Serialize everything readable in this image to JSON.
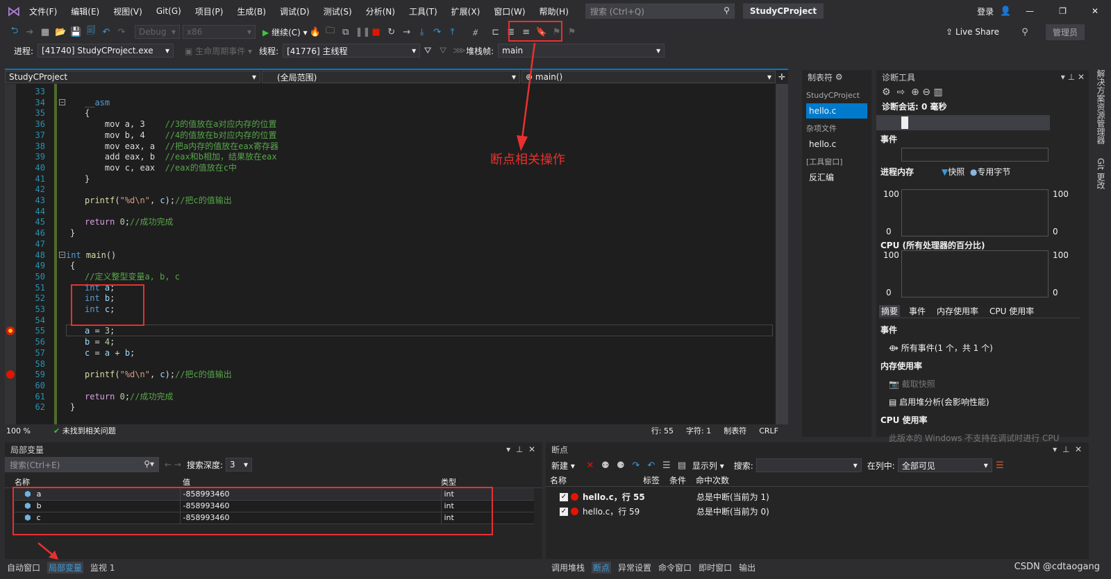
{
  "menu": {
    "items": [
      "文件(F)",
      "编辑(E)",
      "视图(V)",
      "Git(G)",
      "项目(P)",
      "生成(B)",
      "调试(D)",
      "测试(S)",
      "分析(N)",
      "工具(T)",
      "扩展(X)",
      "窗口(W)",
      "帮助(H)"
    ],
    "search_placeholder": "搜索 (Ctrl+Q)",
    "project": "StudyCProject",
    "signin": "登录"
  },
  "toolbar": {
    "config": "Debug",
    "platform": "x86",
    "continue": "继续(C)",
    "live_share": "Live Share",
    "admin": "管理员"
  },
  "debugbar": {
    "process_label": "进程:",
    "process": "[41740] StudyCProject.exe",
    "lifecycle": "生命周期事件",
    "thread_label": "线程:",
    "thread": "[41776] 主线程",
    "stack_label": "堆栈帧:",
    "stack": "main"
  },
  "editor": {
    "project_combo": "StudyCProject",
    "scope_combo": "(全局范围)",
    "func_combo": "main()",
    "zoom": "100 %",
    "issues": "未找到相关问题",
    "row": "行: 55",
    "col": "字符: 1",
    "tabs": "制表符",
    "eol": "CRLF",
    "lines": [
      {
        "n": "33",
        "t": []
      },
      {
        "n": "34",
        "t": [
          {
            "c": "kw",
            "s": "__asm"
          }
        ]
      },
      {
        "n": "35",
        "t": [
          {
            "c": "pl",
            "s": "{"
          }
        ]
      },
      {
        "n": "36",
        "t": [
          {
            "c": "pl",
            "s": "    mov a, 3    "
          },
          {
            "c": "cm",
            "s": "//3的值放在a对应内存的位置"
          }
        ]
      },
      {
        "n": "37",
        "t": [
          {
            "c": "pl",
            "s": "    mov b, 4    "
          },
          {
            "c": "cm",
            "s": "//4的值放在b对应内存的位置"
          }
        ]
      },
      {
        "n": "38",
        "t": [
          {
            "c": "pl",
            "s": "    mov eax, a  "
          },
          {
            "c": "cm",
            "s": "//把a内存的值放在eax寄存器"
          }
        ]
      },
      {
        "n": "39",
        "t": [
          {
            "c": "pl",
            "s": "    add eax, b  "
          },
          {
            "c": "cm",
            "s": "//eax和b相加，结果放在eax"
          }
        ]
      },
      {
        "n": "40",
        "t": [
          {
            "c": "pl",
            "s": "    mov c, eax  "
          },
          {
            "c": "cm",
            "s": "//eax的值放在c中"
          }
        ]
      },
      {
        "n": "41",
        "t": [
          {
            "c": "pl",
            "s": "}"
          }
        ]
      },
      {
        "n": "42",
        "t": []
      },
      {
        "n": "43",
        "t": [
          {
            "c": "fn",
            "s": "printf"
          },
          {
            "c": "pl",
            "s": "("
          },
          {
            "c": "st",
            "s": "\"%d\\n\""
          },
          {
            "c": "pl",
            "s": ", "
          },
          {
            "c": "var",
            "s": "c"
          },
          {
            "c": "pl",
            "s": ");"
          },
          {
            "c": "cm",
            "s": "//把c的值输出"
          }
        ]
      },
      {
        "n": "44",
        "t": []
      },
      {
        "n": "45",
        "t": [
          {
            "c": "ct",
            "s": "return "
          },
          {
            "c": "num",
            "s": "0"
          },
          {
            "c": "pl",
            "s": ";"
          },
          {
            "c": "cm",
            "s": "//成功完成"
          }
        ]
      },
      {
        "n": "46",
        "t": [
          {
            "c": "pl",
            "s": "}"
          }
        ],
        "indent": -1
      },
      {
        "n": "47",
        "t": []
      },
      {
        "n": "48",
        "t": [
          {
            "c": "kw",
            "s": "int "
          },
          {
            "c": "fn",
            "s": "main"
          },
          {
            "c": "pl",
            "s": "()"
          }
        ],
        "indent": -2
      },
      {
        "n": "49",
        "t": [
          {
            "c": "pl",
            "s": "{"
          }
        ],
        "indent": -1
      },
      {
        "n": "50",
        "t": [
          {
            "c": "cm",
            "s": "//定义整型变量a, b, c"
          }
        ]
      },
      {
        "n": "51",
        "t": [
          {
            "c": "kw",
            "s": "int "
          },
          {
            "c": "var",
            "s": "a"
          },
          {
            "c": "pl",
            "s": ";"
          }
        ]
      },
      {
        "n": "52",
        "t": [
          {
            "c": "kw",
            "s": "int "
          },
          {
            "c": "var",
            "s": "b"
          },
          {
            "c": "pl",
            "s": ";"
          }
        ]
      },
      {
        "n": "53",
        "t": [
          {
            "c": "kw",
            "s": "int "
          },
          {
            "c": "var",
            "s": "c"
          },
          {
            "c": "pl",
            "s": ";"
          }
        ]
      },
      {
        "n": "54",
        "t": []
      },
      {
        "n": "55",
        "t": [
          {
            "c": "var",
            "s": "a"
          },
          {
            "c": "pl",
            "s": " = "
          },
          {
            "c": "num",
            "s": "3"
          },
          {
            "c": "pl",
            "s": ";"
          }
        ]
      },
      {
        "n": "56",
        "t": [
          {
            "c": "var",
            "s": "b"
          },
          {
            "c": "pl",
            "s": " = "
          },
          {
            "c": "num",
            "s": "4"
          },
          {
            "c": "pl",
            "s": ";"
          }
        ]
      },
      {
        "n": "57",
        "t": [
          {
            "c": "var",
            "s": "c"
          },
          {
            "c": "pl",
            "s": " = "
          },
          {
            "c": "var",
            "s": "a"
          },
          {
            "c": "pl",
            "s": " + "
          },
          {
            "c": "var",
            "s": "b"
          },
          {
            "c": "pl",
            "s": ";"
          }
        ]
      },
      {
        "n": "58",
        "t": []
      },
      {
        "n": "59",
        "t": [
          {
            "c": "fn",
            "s": "printf"
          },
          {
            "c": "pl",
            "s": "("
          },
          {
            "c": "st",
            "s": "\"%d\\n\""
          },
          {
            "c": "pl",
            "s": ", "
          },
          {
            "c": "var",
            "s": "c"
          },
          {
            "c": "pl",
            "s": ");"
          },
          {
            "c": "cm",
            "s": "//把c的值输出"
          }
        ]
      },
      {
        "n": "60",
        "t": []
      },
      {
        "n": "61",
        "t": [
          {
            "c": "ct",
            "s": "return "
          },
          {
            "c": "num",
            "s": "0"
          },
          {
            "c": "pl",
            "s": ";"
          },
          {
            "c": "cm",
            "s": "//成功完成"
          }
        ]
      },
      {
        "n": "62",
        "t": [
          {
            "c": "pl",
            "s": "}"
          }
        ],
        "indent": -1
      }
    ]
  },
  "annotation": "断点相关操作",
  "tabpanel": {
    "title": "制表符",
    "project": "StudyCProject",
    "file1": "hello.c",
    "misc": "杂项文件",
    "file2": "hello.c",
    "tool": "[工具窗口]",
    "disasm": "反汇编"
  },
  "diag": {
    "title": "诊断工具",
    "session": "诊断会话: 0 毫秒",
    "events": "事件",
    "memory": "进程内存",
    "snapshot": "快照",
    "private": "专用字节",
    "cpu": "CPU (所有处理器的百分比)",
    "max": "100",
    "min": "0",
    "tabs": [
      "摘要",
      "事件",
      "内存使用率",
      "CPU 使用率"
    ],
    "sec_events": "事件",
    "all_events": "所有事件(1 个，共 1 个)",
    "sec_mem": "内存使用率",
    "take_snapshot": "截取快照",
    "heap": "启用堆分析(会影响性能)",
    "sec_cpu": "CPU 使用率",
    "cpu_note": "此版本的 Windows 不支持在调试时进行 CPU"
  },
  "side_tabs": [
    "解决方案资源管理器",
    "Git 更改"
  ],
  "locals": {
    "title": "局部变量",
    "search_placeholder": "搜索(Ctrl+E)",
    "depth_label": "搜索深度:",
    "depth": "3",
    "cols": [
      "名称",
      "值",
      "类型"
    ],
    "rows": [
      {
        "name": "a",
        "value": "-858993460",
        "type": "int"
      },
      {
        "name": "b",
        "value": "-858993460",
        "type": "int"
      },
      {
        "name": "c",
        "value": "-858993460",
        "type": "int"
      }
    ]
  },
  "bottom_left_tabs": [
    "自动窗口",
    "局部变量",
    "监视 1"
  ],
  "breakpoints": {
    "title": "断点",
    "new": "新建",
    "columns_btn": "显示列",
    "search_label": "搜索:",
    "in_col_label": "在列中:",
    "in_col": "全部可见",
    "cols": [
      "名称",
      "标签",
      "条件",
      "命中次数"
    ],
    "rows": [
      {
        "name": "hello.c，行 55",
        "hits": "总是中断(当前为 1)"
      },
      {
        "name": "hello.c，行 59",
        "hits": "总是中断(当前为 0)"
      }
    ]
  },
  "bottom_right_tabs": [
    "调用堆栈",
    "断点",
    "异常设置",
    "命令窗口",
    "即时窗口",
    "输出"
  ],
  "watermark": "CSDN @cdtaogang",
  "colors": {
    "accent": "#007acc",
    "annotation": "#e8312f",
    "breakpoint": "#e51400"
  }
}
